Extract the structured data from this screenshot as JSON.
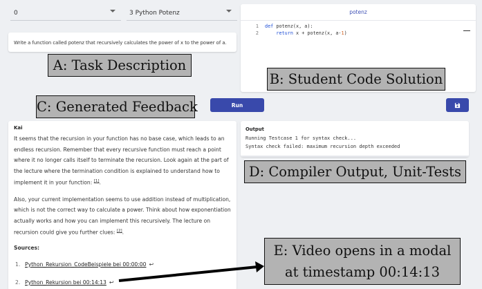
{
  "selects": {
    "week": {
      "value": "0"
    },
    "task": {
      "value": "3 Python Potenz"
    }
  },
  "task": {
    "description": "Write a function called potenz that recursively calculates the power of x to the power of a."
  },
  "editor": {
    "tab": "potenz",
    "lines": [
      {
        "num": "1",
        "kw": "def",
        "rest": " potenz(x, a):"
      },
      {
        "num": "2",
        "kw": "return",
        "rest_a": " x + potenz(x, a",
        "op": "-",
        "numlit": "1",
        "rest_b": ")"
      }
    ]
  },
  "toolbar": {
    "run_label": "Run",
    "save_icon": "floppy-disk-icon"
  },
  "feedback": {
    "author": "Kai",
    "p1": "It seems that the recursion in your function has no base case, which leads to an endless recursion. Remember that every recursive function must reach a point where it no longer calls itself to terminate the recursion. Look again at the part of the lecture where the termination condition is explained to understand how to implement it in your function:",
    "ref1": "[1]",
    "p2": "Also, your current implementation seems to use addition instead of multiplication, which is not the correct way to calculate a power. Think about how exponentiation actually works and how you can implement this recursively. The lecture on recursion could give you further clues:",
    "ref2": "[2]",
    "sources_title": "Sources:",
    "sources": [
      {
        "n": "1.",
        "label": "Python_Rekursion_CodeBeispiele bei 00:00:00"
      },
      {
        "n": "2.",
        "label": "Python_Rekursion bei 00:14:13"
      }
    ]
  },
  "output": {
    "title": "Output",
    "lines": [
      "Running Testcase 1 for syntax check...",
      "Syntax check failed: maximum recursion depth exceeded"
    ]
  },
  "annotations": {
    "a": "A: Task Description",
    "b": "B: Student Code Solution",
    "c": "C: Generated Feedback",
    "d": "D: Compiler Output, Unit-Tests",
    "e_line1": "E: Video opens in a modal",
    "e_line2": "at timestamp 00:14:13"
  },
  "colors": {
    "primary": "#3949ab",
    "keyword": "#1f4fd6",
    "number": "#d05a18",
    "background": "#eef0f3"
  }
}
